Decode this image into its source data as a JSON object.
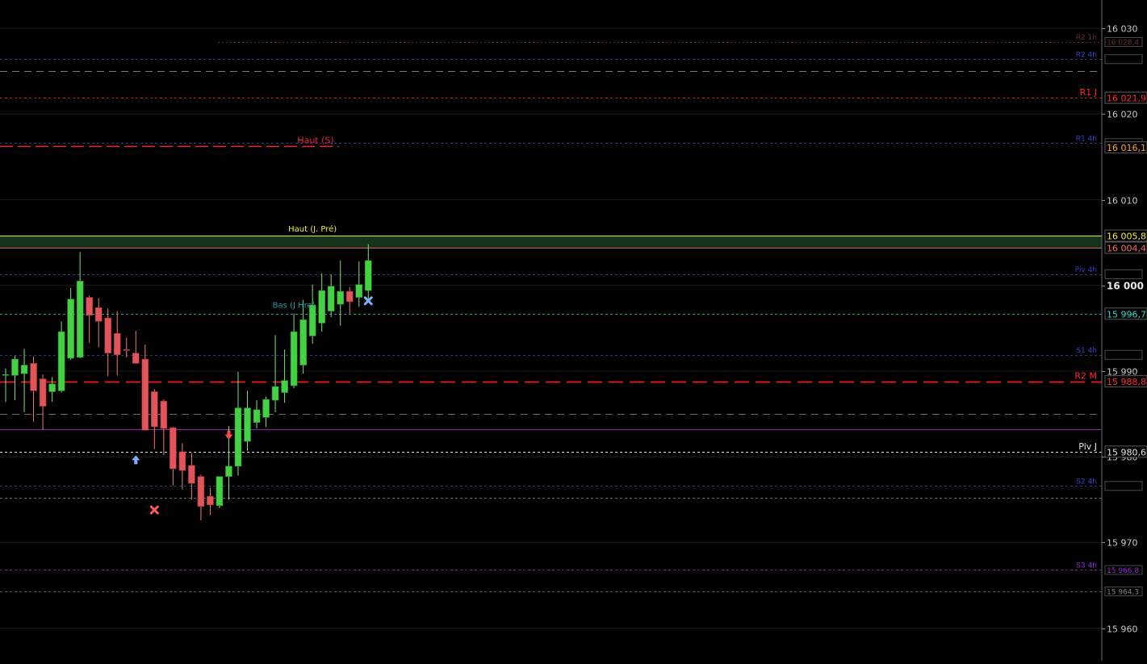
{
  "chart_data": {
    "type": "candlestick",
    "ylim": [
      15956.2,
      16033.3
    ],
    "price_axis": {
      "ticks": [
        {
          "value": 16030,
          "label": "16 030",
          "bold": false
        },
        {
          "value": 16020,
          "label": "16 020",
          "bold": false
        },
        {
          "value": 16010,
          "label": "16 010",
          "bold": false
        },
        {
          "value": 16000,
          "label": "16 000",
          "bold": true
        },
        {
          "value": 15990,
          "label": "15 990",
          "bold": false
        },
        {
          "value": 15980,
          "label": "15 980",
          "bold": false
        },
        {
          "value": 15970,
          "label": "15 970",
          "bold": false
        },
        {
          "value": 15960,
          "label": "15 960",
          "bold": false
        }
      ]
    },
    "candles": [
      {
        "o": 15989.5,
        "h": 15990.3,
        "l": 15986.4,
        "c": 15989.6
      },
      {
        "o": 15989.5,
        "h": 15991.8,
        "l": 15986.6,
        "c": 15991.4
      },
      {
        "o": 15989.7,
        "h": 15992.6,
        "l": 15985.2,
        "c": 15990.7
      },
      {
        "o": 15990.9,
        "h": 15991.7,
        "l": 15984.1,
        "c": 15987.7
      },
      {
        "o": 15989.1,
        "h": 15989.6,
        "l": 15983.1,
        "c": 15985.9
      },
      {
        "o": 15987.6,
        "h": 15989.3,
        "l": 15986.4,
        "c": 15988.5
      },
      {
        "o": 15987.7,
        "h": 15995.8,
        "l": 15987.5,
        "c": 15994.6
      },
      {
        "o": 15991.5,
        "h": 15999.7,
        "l": 15991.3,
        "c": 15998.4
      },
      {
        "o": 15991.6,
        "h": 16003.9,
        "l": 15991.5,
        "c": 16000.5
      },
      {
        "o": 15998.6,
        "h": 15998.8,
        "l": 15993.3,
        "c": 15996.5
      },
      {
        "o": 15997.4,
        "h": 15998.5,
        "l": 15992.8,
        "c": 15995.8
      },
      {
        "o": 15996.2,
        "h": 15997.3,
        "l": 15989.4,
        "c": 15992.1
      },
      {
        "o": 15994.4,
        "h": 15997.0,
        "l": 15989.5,
        "c": 15991.9
      },
      {
        "o": 15992.5,
        "h": 15993.9,
        "l": 15991.6,
        "c": 15992.4
      },
      {
        "o": 15992.1,
        "h": 15994.7,
        "l": 15990.9,
        "c": 15990.9
      },
      {
        "o": 15991.4,
        "h": 15993.1,
        "l": 15986.4,
        "c": 15983.1
      },
      {
        "o": 15987.6,
        "h": 15987.9,
        "l": 15980.9,
        "c": 15983.5
      },
      {
        "o": 15986.5,
        "h": 15986.7,
        "l": 15980.2,
        "c": 15983.3
      },
      {
        "o": 15983.4,
        "h": 15983.5,
        "l": 15976.7,
        "c": 15978.6
      },
      {
        "o": 15980.6,
        "h": 15981.6,
        "l": 15976.2,
        "c": 15978.4
      },
      {
        "o": 15979.0,
        "h": 15980.4,
        "l": 15975.0,
        "c": 15976.9
      },
      {
        "o": 15977.7,
        "h": 15977.9,
        "l": 15972.6,
        "c": 15974.2
      },
      {
        "o": 15975.4,
        "h": 15976.4,
        "l": 15973.2,
        "c": 15974.4
      },
      {
        "o": 15974.3,
        "h": 15977.1,
        "l": 15974.0,
        "c": 15977.7
      },
      {
        "o": 15977.7,
        "h": 15983.6,
        "l": 15975.0,
        "c": 15978.9
      },
      {
        "o": 15978.9,
        "h": 15989.9,
        "l": 15977.8,
        "c": 15985.7
      },
      {
        "o": 15981.8,
        "h": 15987.7,
        "l": 15980.7,
        "c": 15985.7
      },
      {
        "o": 15984.0,
        "h": 15986.6,
        "l": 15983.3,
        "c": 15985.5
      },
      {
        "o": 15984.6,
        "h": 15987.0,
        "l": 15983.5,
        "c": 15986.7
      },
      {
        "o": 15986.6,
        "h": 15994.2,
        "l": 15985.2,
        "c": 15988.2
      },
      {
        "o": 15987.5,
        "h": 15992.5,
        "l": 15986.3,
        "c": 15988.9
      },
      {
        "o": 15988.3,
        "h": 15996.7,
        "l": 15988.0,
        "c": 15994.6
      },
      {
        "o": 15990.7,
        "h": 15998.3,
        "l": 15989.7,
        "c": 15996.0
      },
      {
        "o": 15994.1,
        "h": 16000.1,
        "l": 15993.2,
        "c": 15997.7
      },
      {
        "o": 15995.6,
        "h": 16001.4,
        "l": 15994.6,
        "c": 15999.4
      },
      {
        "o": 15997.0,
        "h": 16001.3,
        "l": 15996.3,
        "c": 15999.9
      },
      {
        "o": 15997.8,
        "h": 16002.9,
        "l": 15995.3,
        "c": 15999.3
      },
      {
        "o": 15999.3,
        "h": 15999.8,
        "l": 15996.7,
        "c": 15998.1
      },
      {
        "o": 15998.6,
        "h": 16002.8,
        "l": 15997.5,
        "c": 16000.1
      },
      {
        "o": 15999.4,
        "h": 16004.8,
        "l": 15998.1,
        "c": 16002.9
      }
    ],
    "levels": [
      {
        "name": "R2 1h",
        "price": 16028.4,
        "price_label": "16 028,4",
        "color": "#6a2a3a",
        "style": "dotted",
        "dash": "2,3",
        "width": 1,
        "x_start": 270,
        "label_color": "#6a2a3a",
        "box_dim": true
      },
      {
        "name": "R2 4h",
        "price": 16026.4,
        "price_label": "",
        "color": "#2a3b8a",
        "style": "dashed",
        "dash": "3,3",
        "width": 1,
        "x_start": 0,
        "label_color": "#2d44c8",
        "box_dim": true
      },
      {
        "name": "",
        "price": 16025.0,
        "price_label": "",
        "color": "#7a7a7a",
        "style": "dashed",
        "dash": "9,6",
        "width": 1,
        "x_start": 0,
        "label_color": "#7a7a7a",
        "box_dim": false
      },
      {
        "name": "R1 J",
        "price": 16021.9,
        "price_label": "16 021,9",
        "color": "#d01818",
        "style": "dashed",
        "dash": "3,3",
        "width": 1,
        "x_start": 0,
        "label_color": "#ff2a2a",
        "box_dim": false
      },
      {
        "name": "R1 4h",
        "price": 16016.6,
        "price_label": "",
        "color": "#26388a",
        "style": "dashed",
        "dash": "3,3",
        "width": 1,
        "x_start": 0,
        "label_color": "#2d44c8",
        "box_dim": true
      },
      {
        "name": "",
        "price": 16016.1,
        "price_label": "16 016,1",
        "color": "#c8961a",
        "style": "solid",
        "dash": "",
        "width": 1,
        "x_start": 1365,
        "label_color": "#ffa21a",
        "box_dim": false
      },
      {
        "name": "Haut (J. Pré)",
        "price": 16005.8,
        "price_label": "16 005,8",
        "color": "#e8e430",
        "style": "solid",
        "dash": "",
        "width": 1,
        "x_start": 0,
        "label_color": "#f2ee3a",
        "box_dim": false
      },
      {
        "name": "",
        "price": 16004.4,
        "price_label": "16 004,4",
        "color": "#d8605a",
        "style": "solid",
        "dash": "",
        "width": 1,
        "x_start": 0,
        "label_color": "#ff6a60",
        "box_dim": false
      },
      {
        "name": "Piv 4h",
        "price": 16001.3,
        "price_label": "",
        "color": "#26388a",
        "style": "dashed",
        "dash": "3,3",
        "width": 1,
        "x_start": 0,
        "label_color": "#2d44c8",
        "box_dim": true
      },
      {
        "name": "",
        "price": 15996.7,
        "price_label": "15 996,7",
        "color": "#1e9d9a",
        "style": "dashed",
        "dash": "3,3",
        "width": 1,
        "x_start": 0,
        "label_color": "#2ed8d0",
        "box_dim": false
      },
      {
        "name": "S1 4h",
        "price": 15991.9,
        "price_label": "",
        "color": "#26388a",
        "style": "dashed",
        "dash": "3,3",
        "width": 1,
        "x_start": 0,
        "label_color": "#2d44c8",
        "box_dim": true
      },
      {
        "name": "R2 M",
        "price": 15988.8,
        "price_label": "15 988,8",
        "color": "#d81a1a",
        "style": "dashed",
        "dash": "18,8",
        "width": 2,
        "x_start": 0,
        "label_color": "#ff2a2a",
        "box_dim": false
      },
      {
        "name": "",
        "price": 15985.0,
        "price_label": "",
        "color": "#6a6a6a",
        "style": "dashed",
        "dash": "9,6",
        "width": 1,
        "x_start": 0,
        "label_color": "#6a6a6a",
        "box_dim": false
      },
      {
        "name": "",
        "price": 15983.2,
        "price_label": "",
        "color": "#8a28a8",
        "style": "solid",
        "dash": "",
        "width": 1,
        "x_start": 0,
        "label_color": "#8a28a8",
        "box_dim": false
      },
      {
        "name": "Piv J",
        "price": 15980.6,
        "price_label": "15 980,6",
        "color": "#e6e6e6",
        "style": "dashed",
        "dash": "3,3",
        "width": 1,
        "x_start": 0,
        "label_color": "#e6e6e6",
        "box_dim": false
      },
      {
        "name": "S2 4h",
        "price": 15976.6,
        "price_label": "",
        "color": "#26388a",
        "style": "dashed",
        "dash": "3,3",
        "width": 1,
        "x_start": 0,
        "label_color": "#2d44c8",
        "box_dim": true
      },
      {
        "name": "",
        "price": 15975.2,
        "price_label": "",
        "color": "#6a6a6a",
        "style": "dashed",
        "dash": "3,3",
        "width": 1,
        "x_start": 0,
        "label_color": "#6a6a6a",
        "box_dim": false
      },
      {
        "name": "S3 4h",
        "price": 15966.8,
        "price_label": "15 966,8",
        "color": "#7a1aa8",
        "style": "dashed",
        "dash": "3,3",
        "width": 1,
        "x_start": 0,
        "label_color": "#9a2ad8",
        "box_dim": true
      },
      {
        "name": "",
        "price": 15964.3,
        "price_label": "15 964,3",
        "color": "#5a4a5a",
        "style": "dashed",
        "dash": "3,3",
        "width": 1,
        "x_start": 0,
        "label_color": "#8a7a8a",
        "box_dim": true
      }
    ],
    "zone": {
      "from": 16004.4,
      "to": 16005.8,
      "color": "#14331a"
    },
    "haut_s": {
      "label": "Haut (S)",
      "price": 16016.3,
      "color": "#e8263a"
    },
    "annotations": [
      {
        "text": "Haut (J. Pré)",
        "candle": 33,
        "price": 16006.3,
        "color": "#f2ee3a"
      },
      {
        "text": "Bas (J Hre)",
        "candle": 31,
        "price": 15997.4,
        "color": "#1e9d9a"
      }
    ],
    "markers": [
      {
        "candle": 14,
        "type": "arrow-up",
        "price": 15979.6,
        "color": "#7fb0ff"
      },
      {
        "candle": 16,
        "type": "cross",
        "price": 15973.8,
        "color": "#ff5a5a"
      },
      {
        "candle": 24,
        "type": "arrow-down",
        "price": 15982.6,
        "color": "#ff4a4a"
      },
      {
        "candle": 39,
        "type": "cross",
        "price": 15998.2,
        "color": "#7fb0ff"
      }
    ],
    "grid": false,
    "legend": "none"
  }
}
